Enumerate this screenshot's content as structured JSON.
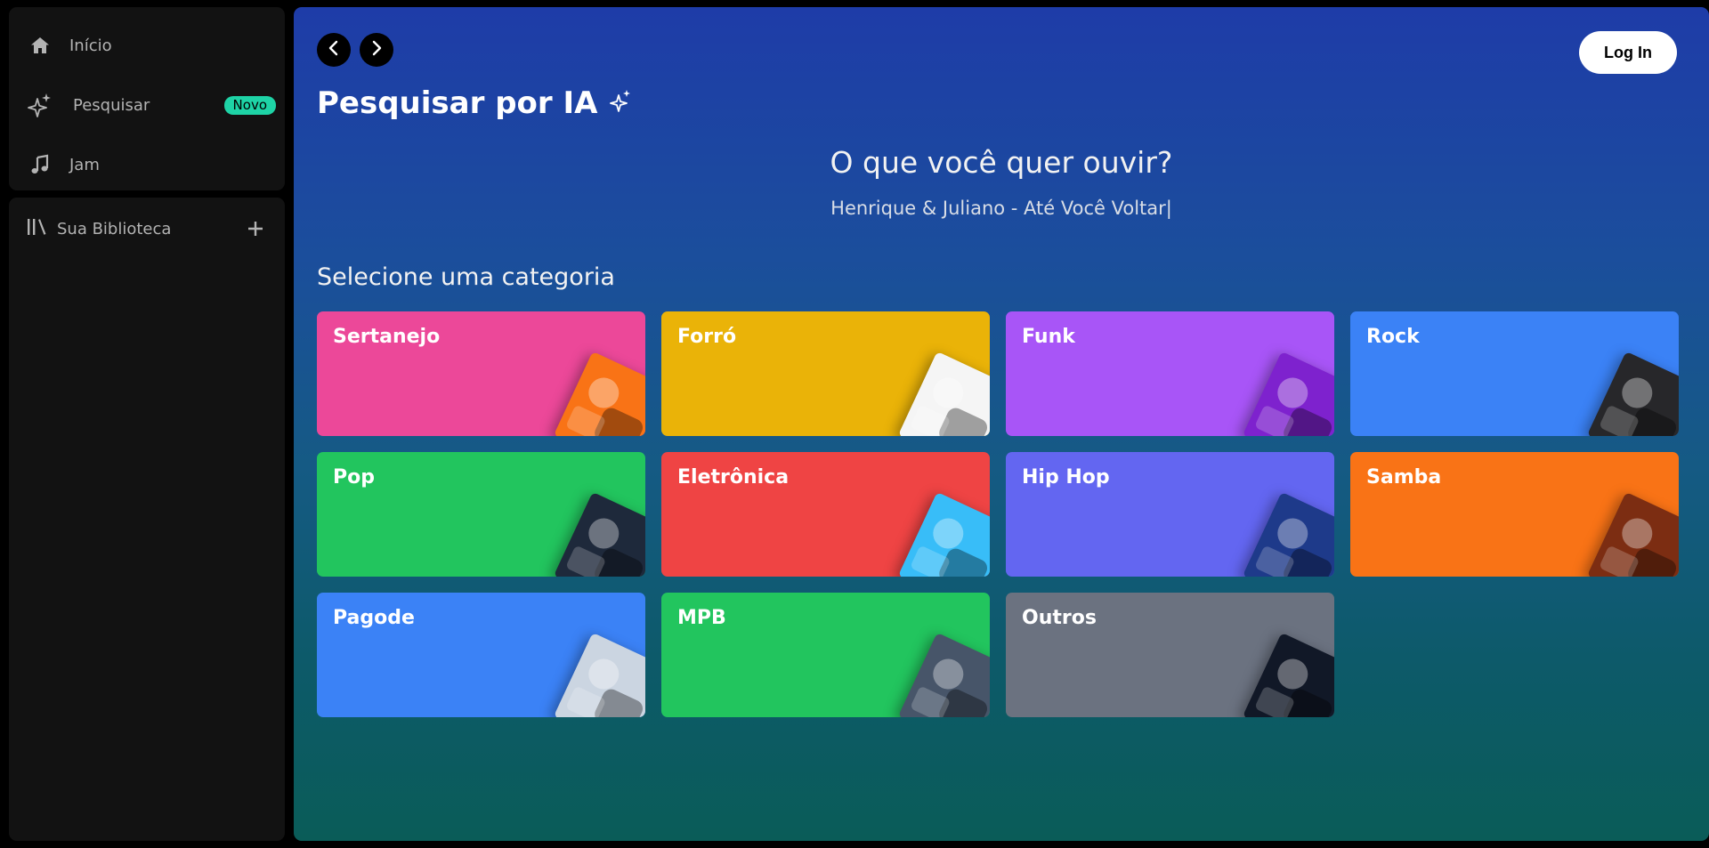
{
  "sidebar": {
    "nav": [
      {
        "label": "Início",
        "icon": "home-icon"
      },
      {
        "label": "Pesquisar",
        "icon": "sparkles-icon",
        "badge": "Novo"
      },
      {
        "label": "Jam",
        "icon": "music-note-icon"
      }
    ],
    "library": {
      "label": "Sua Biblioteca",
      "icon": "library-icon",
      "add_icon": "plus-icon"
    }
  },
  "header": {
    "back_icon": "chevron-left-icon",
    "forward_icon": "chevron-right-icon",
    "login_label": "Log In"
  },
  "main": {
    "title": "Pesquisar por IA",
    "title_icon": "sparkles-icon",
    "question": "O que você quer ouvir?",
    "typed_text": "Henrique & Juliano - Até Você Voltar|",
    "section_title": "Selecione uma categoria",
    "categories": [
      {
        "name": "Sertanejo",
        "color": "#ec4899",
        "art": "#f97316"
      },
      {
        "name": "Forró",
        "color": "#eab308",
        "art": "#f5f5f5"
      },
      {
        "name": "Funk",
        "color": "#a855f7",
        "art": "#7e22ce"
      },
      {
        "name": "Rock",
        "color": "#3b82f6",
        "art": "#27272a"
      },
      {
        "name": "Pop",
        "color": "#22c55e",
        "art": "#1e293b"
      },
      {
        "name": "Eletrônica",
        "color": "#ef4444",
        "art": "#38bdf8"
      },
      {
        "name": "Hip Hop",
        "color": "#6366f1",
        "art": "#1e3a8a"
      },
      {
        "name": "Samba",
        "color": "#f97316",
        "art": "#7c2d12"
      },
      {
        "name": "Pagode",
        "color": "#3b82f6",
        "art": "#cbd5e1"
      },
      {
        "name": "MPB",
        "color": "#22c55e",
        "art": "#475569"
      },
      {
        "name": "Outros",
        "color": "#6b7280",
        "art": "#111827"
      }
    ]
  },
  "colors": {
    "badge": "#1ed3a6",
    "sidebar_bg": "#121212"
  }
}
